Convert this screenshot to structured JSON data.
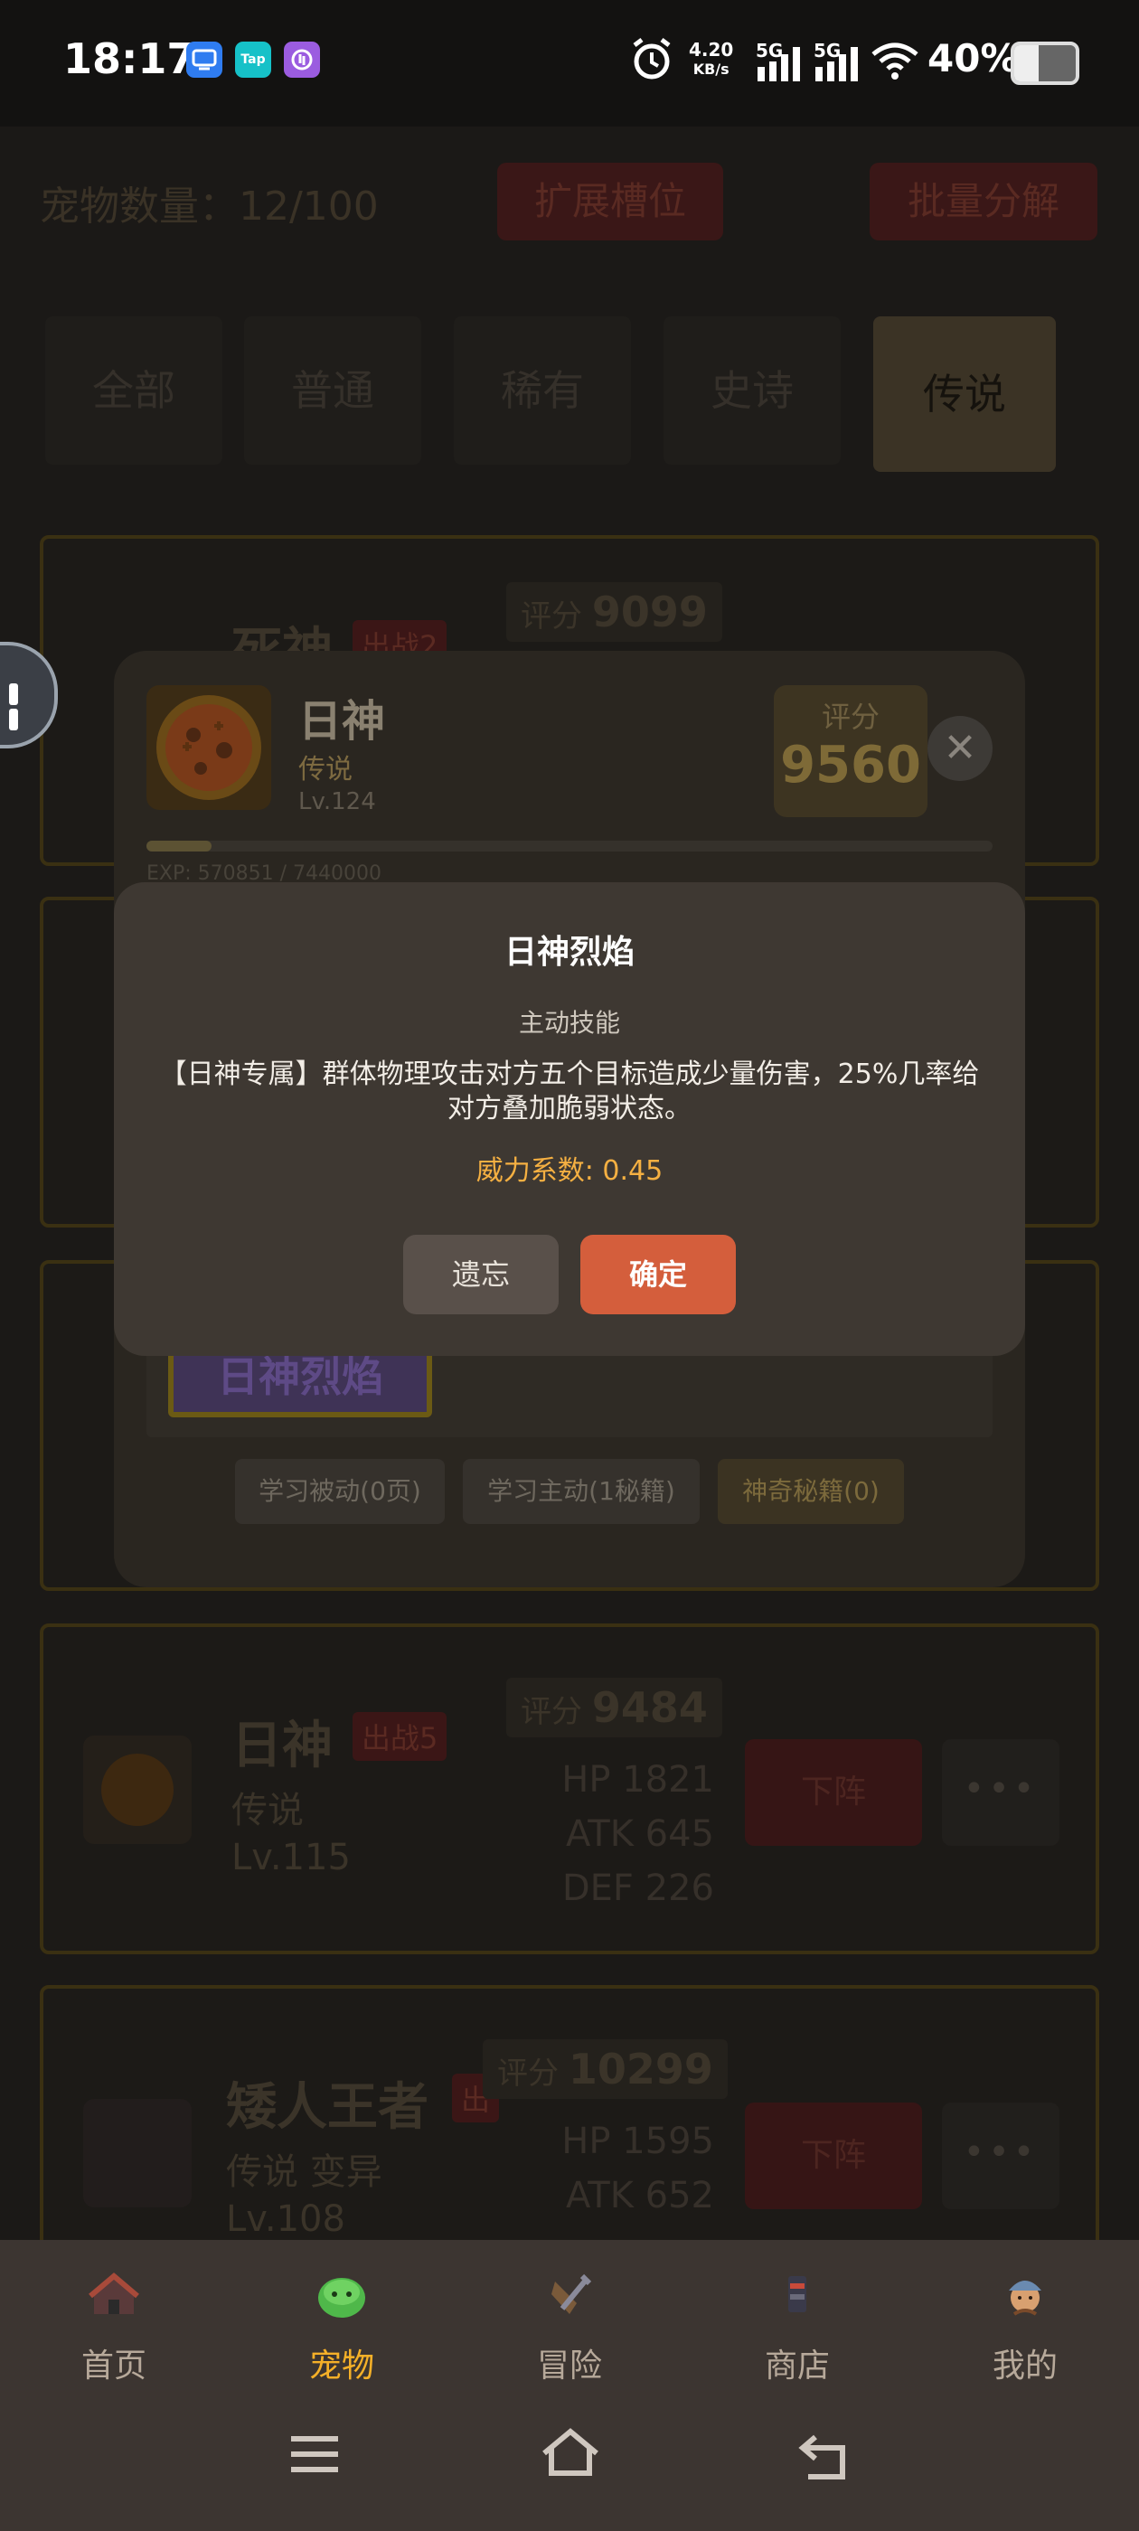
{
  "status_bar": {
    "time": "18:17",
    "apps": [
      "Tap"
    ],
    "net_speed": "4.20",
    "net_unit": "KB/s",
    "sig1": "5G",
    "sig2": "5G",
    "battery": "40%",
    "battery_level": 0.4
  },
  "background_page": {
    "pet_count": "宠物数量：12/100",
    "expand_button": "扩展槽位",
    "batch_button": "批量分解",
    "filter_tabs": [
      "全部",
      "普通",
      "稀有",
      "史诗",
      "传说"
    ],
    "cards": [
      {
        "name": "死神",
        "tag": "出战2",
        "score_label": "评分",
        "score": "9099"
      },
      {
        "name": "日神",
        "tag": "出战5",
        "score_label": "评分",
        "score": "9484",
        "rarity": "传说",
        "level": "Lv.115",
        "hp": "HP 1821",
        "atk": "ATK 645",
        "def": "DEF 226",
        "action": "下阵",
        "more": "•••"
      },
      {
        "name": "矮人王者",
        "tag": "出",
        "score_label": "评分",
        "score": "10299",
        "rarity": "传说 变异",
        "level": "Lv.108",
        "hp": "HP 1595",
        "atk": "ATK 652",
        "action": "下阵",
        "more": "•••"
      }
    ]
  },
  "detail_panel": {
    "name": "日神",
    "rarity": "传说",
    "level": "Lv.124",
    "score_label": "评分",
    "score": "9560",
    "exp_text": "EXP: 570851 / 7440000",
    "exp_fraction": 0.077,
    "skill_chip": "日神烈焰",
    "learn_buttons": [
      "学习被动(0页)",
      "学习主动(1秘籍)",
      "神奇秘籍(0)"
    ]
  },
  "modal": {
    "title": "日神烈焰",
    "type": "主动技能",
    "description": "【日神专属】群体物理攻击对方五个目标造成少量伤害，25%几率给对方叠加脆弱状态。",
    "power": "威力系数: 0.45",
    "forget_button": "遗忘",
    "confirm_button": "确定"
  },
  "bottom_nav": {
    "items": [
      {
        "label": "首页",
        "icon": "home-house-icon"
      },
      {
        "label": "宠物",
        "icon": "green-slime-pet-icon"
      },
      {
        "label": "冒险",
        "icon": "sword-shield-icon"
      },
      {
        "label": "商店",
        "icon": "shop-stall-icon"
      },
      {
        "label": "我的",
        "icon": "avatar-profile-icon"
      }
    ],
    "active_index": 1
  },
  "colors": {
    "accent": "#f5b028",
    "confirm": "#d45e3c",
    "power_text": "#f5b042"
  }
}
